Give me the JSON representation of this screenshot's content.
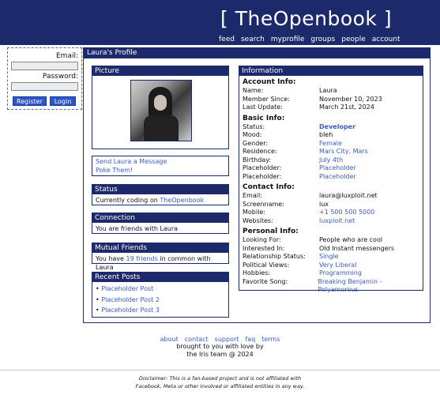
{
  "header": {
    "logo": "[ TheOpenbook ]",
    "nav": [
      "feed",
      "search",
      "myprofile",
      "groups",
      "people",
      "account"
    ]
  },
  "login": {
    "email_label": "Email:",
    "password_label": "Password:",
    "register": "Register",
    "login": "Login"
  },
  "profile": {
    "title": "Laura's Profile",
    "picture_header": "Picture",
    "actions": [
      "Send Laura a Message",
      "Poke Them!"
    ],
    "status": {
      "header": "Status",
      "prefix": "Currently coding on ",
      "link": "TheOpenbook"
    },
    "connection": {
      "header": "Connection",
      "text": "You are friends with Laura"
    },
    "mutual": {
      "header": "Mutual Friends",
      "prefix": "You have ",
      "link": "19 friends",
      "suffix": " in common with Laura"
    },
    "posts": {
      "header": "Recent Posts",
      "items": [
        "Placeholder Post",
        "Placeholder Post 2",
        "Placeholder Post 3"
      ]
    }
  },
  "information": {
    "header": "Information",
    "account_title": "Account Info:",
    "account": [
      {
        "k": "Name:",
        "v": "Laura"
      },
      {
        "k": "Member Since:",
        "v": "November 10, 2023"
      },
      {
        "k": "Last Update:",
        "v": "March 21st, 2024"
      }
    ],
    "basic_title": "Basic Info:",
    "basic": [
      {
        "k": "Status:",
        "v": "Developer"
      },
      {
        "k": "Mood:",
        "v": "bleh"
      },
      {
        "k": "Gender:",
        "v": "Female"
      },
      {
        "k": "Residence:",
        "v": "Mars City, Mars"
      },
      {
        "k": "Birthday:",
        "v": "July 4th"
      },
      {
        "k": "Placeholder:",
        "v": "Placeholder"
      },
      {
        "k": "Placeholder:",
        "v": "Placeholder"
      }
    ],
    "contact_title": "Contact Info:",
    "contact": [
      {
        "k": "Email:",
        "v": "laura@luxploit.net"
      },
      {
        "k": "Screenname:",
        "v": "lux"
      },
      {
        "k": "Mobile:",
        "v": "+1 500 500 5000"
      },
      {
        "k": "Websites:",
        "v": "luxploit.net"
      }
    ],
    "personal_title": "Personal Info:",
    "personal": [
      {
        "k": "Looking For:",
        "v": "People who are cool"
      },
      {
        "k": "Interested In:",
        "v": "Old Instant messengers"
      },
      {
        "k": "Relationship Status:",
        "v": "Single"
      },
      {
        "k": "Political Views:",
        "v": "Very Liberal"
      },
      {
        "k": "Hobbies:",
        "v": "Programming"
      },
      {
        "k": "Favorite Song:",
        "v": "Breaking Benjamin - Polyamorous"
      }
    ]
  },
  "footer": {
    "links": [
      "about",
      "contact",
      "support",
      "faq",
      "terms"
    ],
    "line1": "brought to you with love by",
    "line2": "the Iris team @ 2024",
    "disclaimer1": "Disclaimer: This is a fan-based project and is not affiliated with",
    "disclaimer2": "Facebook, Meta or other involved or affiliated entities in any way."
  }
}
